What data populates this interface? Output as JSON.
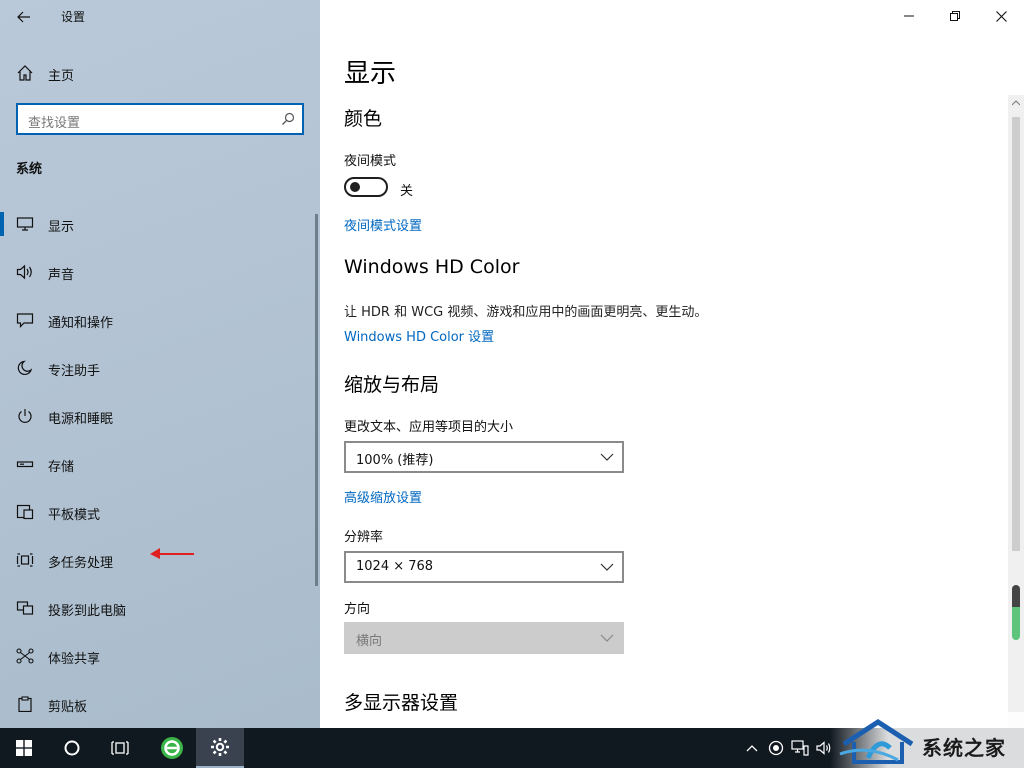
{
  "window": {
    "app_title": "设置"
  },
  "sidebar": {
    "home_label": "主页",
    "search_placeholder": "查找设置",
    "section_title": "系统",
    "items": [
      {
        "label": "显示",
        "icon": "monitor-icon",
        "selected": true
      },
      {
        "label": "声音",
        "icon": "speaker-icon",
        "selected": false
      },
      {
        "label": "通知和操作",
        "icon": "notification-icon",
        "selected": false
      },
      {
        "label": "专注助手",
        "icon": "moon-icon",
        "selected": false
      },
      {
        "label": "电源和睡眠",
        "icon": "power-icon",
        "selected": false
      },
      {
        "label": "存储",
        "icon": "storage-icon",
        "selected": false
      },
      {
        "label": "平板模式",
        "icon": "tablet-mode-icon",
        "selected": false
      },
      {
        "label": "多任务处理",
        "icon": "multitasking-icon",
        "selected": false
      },
      {
        "label": "投影到此电脑",
        "icon": "project-icon",
        "selected": false
      },
      {
        "label": "体验共享",
        "icon": "shared-experience-icon",
        "selected": false
      },
      {
        "label": "剪贴板",
        "icon": "clipboard-icon",
        "selected": false
      }
    ]
  },
  "main": {
    "title": "显示",
    "color": {
      "heading": "颜色",
      "night_light_label": "夜间模式",
      "night_light_state": "关",
      "night_light_on": false,
      "night_light_settings_link": "夜间模式设置"
    },
    "hdr": {
      "heading": "Windows HD Color",
      "description": "让 HDR 和 WCG 视频、游戏和应用中的画面更明亮、更生动。",
      "settings_link": "Windows HD Color 设置"
    },
    "scale": {
      "heading": "缩放与布局",
      "size_label": "更改文本、应用等项目的大小",
      "size_value": "100% (推荐)",
      "advanced_link": "高级缩放设置",
      "resolution_label": "分辨率",
      "resolution_value": "1024 × 768",
      "orientation_label": "方向",
      "orientation_value": "横向"
    },
    "multi_display": {
      "heading": "多显示器设置"
    }
  },
  "watermark": {
    "text": "系统之家"
  },
  "colors": {
    "accent": "#0063b1",
    "link": "#0067c0",
    "taskbar": "#101820",
    "annotation_arrow": "#e02020"
  }
}
